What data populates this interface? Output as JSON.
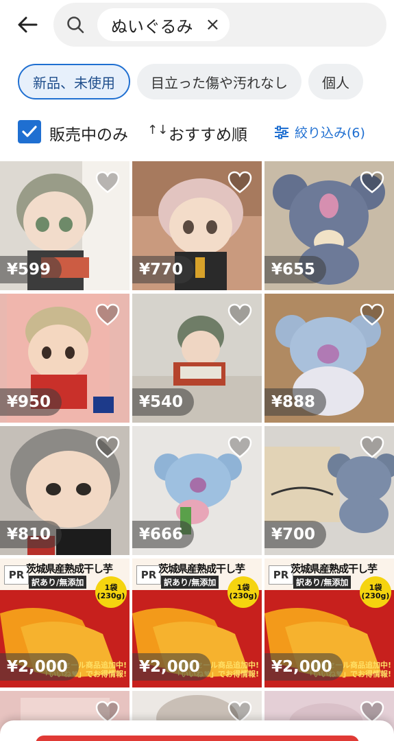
{
  "header": {
    "back_icon": "arrow-left-icon",
    "search_icon": "search-icon",
    "query": "ぬいぐるみ",
    "clear_icon": "close-icon",
    "clear_label": "×"
  },
  "filters": {
    "chips": [
      {
        "label": "新品、未使用",
        "selected": true
      },
      {
        "label": "目立った傷や汚れなし",
        "selected": false
      },
      {
        "label": "個人",
        "selected": false
      }
    ]
  },
  "sortbar": {
    "sale_only_label": "販売中のみ",
    "sale_only_checked": true,
    "sort_icon": "↑↓",
    "sort_label": "おすすめ順",
    "filter_label": "絞り込み(6)",
    "filter_icon": "sliders-icon"
  },
  "items": [
    {
      "price": "¥599"
    },
    {
      "price": "¥770"
    },
    {
      "price": "¥655"
    },
    {
      "price": "¥950"
    },
    {
      "price": "¥540"
    },
    {
      "price": "¥888"
    },
    {
      "price": "¥810"
    },
    {
      "price": "¥666"
    },
    {
      "price": "¥700"
    }
  ],
  "ads": [
    {
      "badge": "PR",
      "headline": "茨城県産熟成干し芋",
      "subline": "訳あり/無添加",
      "bag_top": "1袋",
      "bag_bottom": "(230g)",
      "foot1": "毎日セール商品追加中!",
      "foot2": "「いいね♥」でお得情報!",
      "price": "¥2,000"
    },
    {
      "badge": "PR",
      "headline": "茨城県産熟成干し芋",
      "subline": "訳あり/無添加",
      "bag_top": "1袋",
      "bag_bottom": "(230g)",
      "foot1": "毎日セール商品追加中!",
      "foot2": "「いいね♥」でお得情報!",
      "price": "¥2,000"
    },
    {
      "badge": "PR",
      "headline": "茨城県産熟成干し芋",
      "subline": "訳あり/無添加",
      "bag_top": "1袋",
      "bag_bottom": "(230g)",
      "foot1": "毎日セール商品追加中!",
      "foot2": "「いいね♥」でお得情報!",
      "price": "¥2,000"
    }
  ],
  "colors": {
    "accent": "#1f6fd1",
    "cta": "#e03a35"
  }
}
